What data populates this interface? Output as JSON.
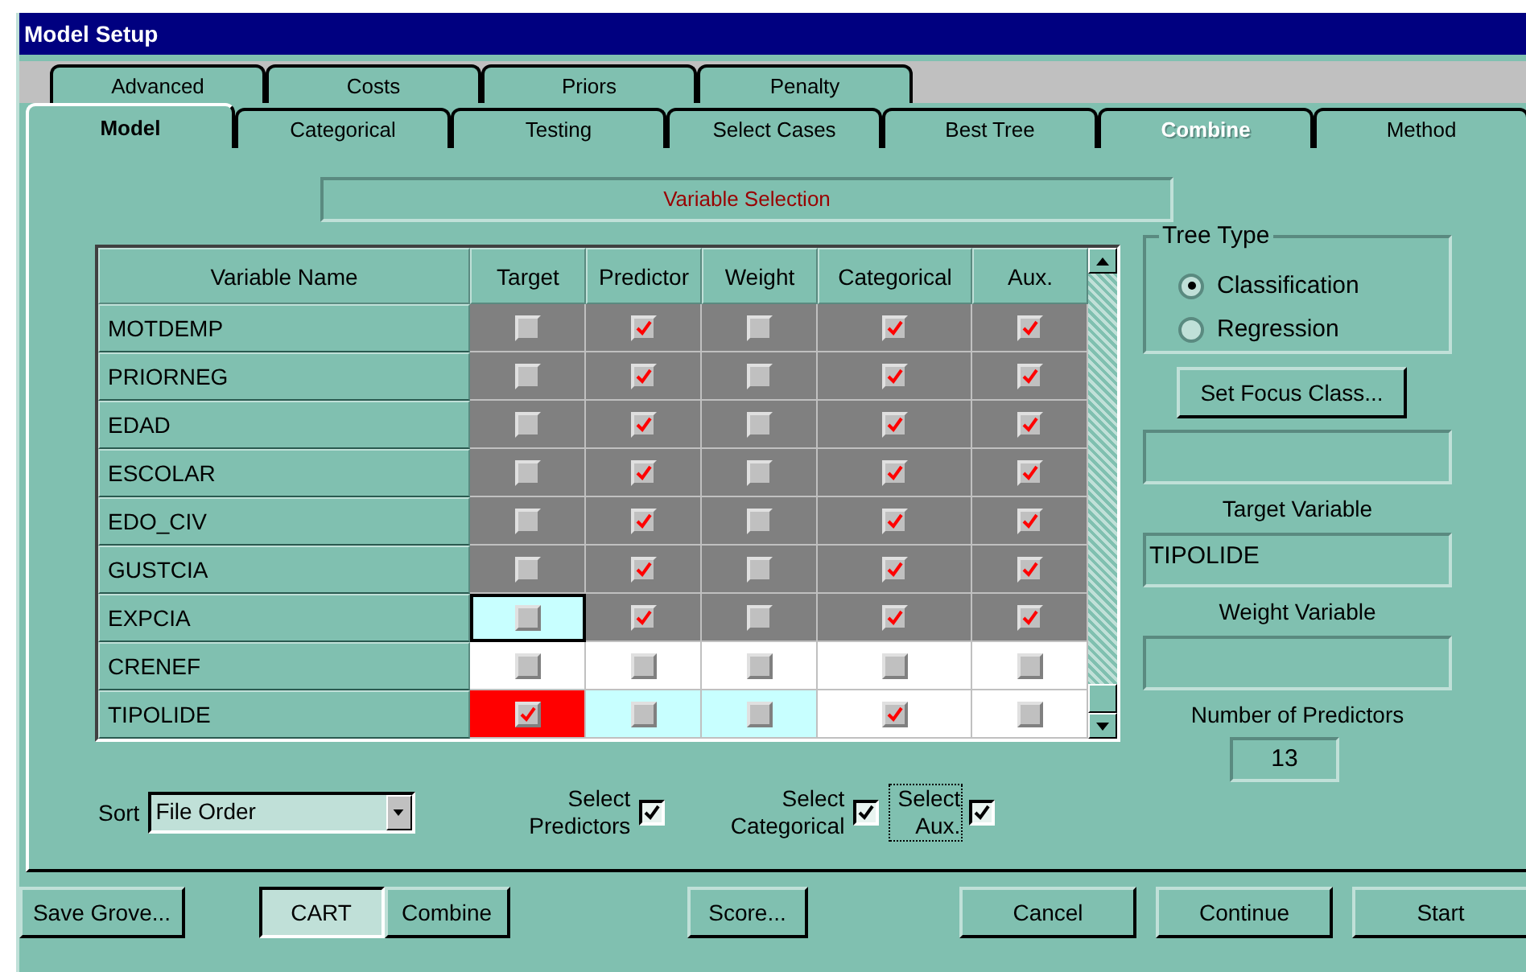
{
  "window": {
    "title": "Model Setup"
  },
  "tab_rows": [
    [
      {
        "label": "Advanced",
        "selected": false,
        "disabled": false
      },
      {
        "label": "Costs",
        "selected": false,
        "disabled": false
      },
      {
        "label": "Priors",
        "selected": false,
        "disabled": false
      },
      {
        "label": "Penalty",
        "selected": false,
        "disabled": false
      }
    ],
    [
      {
        "label": "Model",
        "selected": true,
        "disabled": false
      },
      {
        "label": "Categorical",
        "selected": false,
        "disabled": false
      },
      {
        "label": "Testing",
        "selected": false,
        "disabled": false
      },
      {
        "label": "Select Cases",
        "selected": false,
        "disabled": false
      },
      {
        "label": "Best Tree",
        "selected": false,
        "disabled": false
      },
      {
        "label": "Combine",
        "selected": false,
        "disabled": true
      },
      {
        "label": "Method",
        "selected": false,
        "disabled": false
      }
    ]
  ],
  "section_title": "Variable Selection",
  "table": {
    "columns": [
      "Variable Name",
      "Target",
      "Predictor",
      "Weight",
      "Categorical",
      "Aux."
    ],
    "rows": [
      {
        "name": "MOTDEMP",
        "cells": [
          {
            "checked": false,
            "color": "#808080"
          },
          {
            "checked": true,
            "color": "#808080"
          },
          {
            "checked": false,
            "color": "#808080"
          },
          {
            "checked": true,
            "color": "#808080"
          },
          {
            "checked": true,
            "color": "#808080"
          }
        ]
      },
      {
        "name": "PRIORNEG",
        "cells": [
          {
            "checked": false,
            "color": "#808080"
          },
          {
            "checked": true,
            "color": "#808080"
          },
          {
            "checked": false,
            "color": "#808080"
          },
          {
            "checked": true,
            "color": "#808080"
          },
          {
            "checked": true,
            "color": "#808080"
          }
        ]
      },
      {
        "name": "EDAD",
        "cells": [
          {
            "checked": false,
            "color": "#808080"
          },
          {
            "checked": true,
            "color": "#808080"
          },
          {
            "checked": false,
            "color": "#808080"
          },
          {
            "checked": true,
            "color": "#808080"
          },
          {
            "checked": true,
            "color": "#808080"
          }
        ]
      },
      {
        "name": "ESCOLAR",
        "cells": [
          {
            "checked": false,
            "color": "#808080"
          },
          {
            "checked": true,
            "color": "#808080"
          },
          {
            "checked": false,
            "color": "#808080"
          },
          {
            "checked": true,
            "color": "#808080"
          },
          {
            "checked": true,
            "color": "#808080"
          }
        ]
      },
      {
        "name": "EDO_CIV",
        "cells": [
          {
            "checked": false,
            "color": "#808080"
          },
          {
            "checked": true,
            "color": "#808080"
          },
          {
            "checked": false,
            "color": "#808080"
          },
          {
            "checked": true,
            "color": "#808080"
          },
          {
            "checked": true,
            "color": "#808080"
          }
        ]
      },
      {
        "name": "GUSTCIA",
        "cells": [
          {
            "checked": false,
            "color": "#808080"
          },
          {
            "checked": true,
            "color": "#808080"
          },
          {
            "checked": false,
            "color": "#808080"
          },
          {
            "checked": true,
            "color": "#808080"
          },
          {
            "checked": true,
            "color": "#808080"
          }
        ]
      },
      {
        "name": "EXPCIA",
        "cells": [
          {
            "checked": false,
            "color": "#c8ffff",
            "selected": true
          },
          {
            "checked": true,
            "color": "#808080"
          },
          {
            "checked": false,
            "color": "#808080"
          },
          {
            "checked": true,
            "color": "#808080"
          },
          {
            "checked": true,
            "color": "#808080"
          }
        ]
      },
      {
        "name": "CRENEF",
        "cells": [
          {
            "checked": false,
            "color": "#ffffff"
          },
          {
            "checked": false,
            "color": "#ffffff"
          },
          {
            "checked": false,
            "color": "#ffffff"
          },
          {
            "checked": false,
            "color": "#ffffff"
          },
          {
            "checked": false,
            "color": "#ffffff"
          }
        ]
      },
      {
        "name": "TIPOLIDE",
        "cells": [
          {
            "checked": true,
            "color": "#ff0000"
          },
          {
            "checked": false,
            "color": "#c8ffff"
          },
          {
            "checked": false,
            "color": "#c8ffff"
          },
          {
            "checked": true,
            "color": "#ffffff"
          },
          {
            "checked": false,
            "color": "#ffffff"
          }
        ]
      }
    ]
  },
  "tree_type": {
    "title": "Tree Type",
    "options": [
      {
        "label": "Classification",
        "selected": true
      },
      {
        "label": "Regression",
        "selected": false
      }
    ]
  },
  "focus_button": "Set Focus Class...",
  "target_label": "Target Variable",
  "target_value": "TIPOLIDE",
  "weight_label": "Weight Variable",
  "predictors_label": "Number of Predictors",
  "predictors_count": "13",
  "sort": {
    "label": "Sort",
    "value": "File Order"
  },
  "select_checks": [
    {
      "label": "Select Predictors",
      "checked": true,
      "focused": false
    },
    {
      "label": "Select Categorical",
      "checked": true,
      "focused": false
    },
    {
      "label": "Select Aux.",
      "checked": true,
      "focused": true
    }
  ],
  "buttons": {
    "save": "Save Grove...",
    "modes": [
      {
        "label": "CART",
        "selected": true
      },
      {
        "label": "Combine",
        "selected": false
      }
    ],
    "score": "Score...",
    "actions": [
      "Cancel",
      "Continue",
      "Start"
    ]
  }
}
